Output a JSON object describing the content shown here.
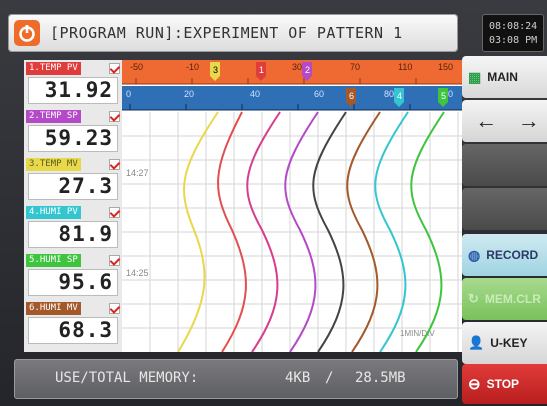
{
  "header": {
    "title": "[PROGRAM RUN]:EXPERIMENT OF PATTERN 1"
  },
  "clock": {
    "line1": "08:08:24",
    "line2": "03:08 PM"
  },
  "channels": [
    {
      "tag": "1.TEMP PV",
      "value": "31.92",
      "color": "#e03c3c",
      "text_color": "#ffffff"
    },
    {
      "tag": "2.TEMP SP",
      "value": "59.23",
      "color": "#b44ac8",
      "text_color": "#ffffff"
    },
    {
      "tag": "3.TEMP MV",
      "value": "27.3",
      "color": "#e8d84a",
      "text_color": "#5a5a22"
    },
    {
      "tag": "4.HUMI PV",
      "value": "81.9",
      "color": "#34c6d0",
      "text_color": "#ffffff"
    },
    {
      "tag": "5.HUMI SP",
      "value": "95.6",
      "color": "#3fc43f",
      "text_color": "#ffffff"
    },
    {
      "tag": "6.HUMI MV",
      "value": "68.3",
      "color": "#a3592a",
      "text_color": "#ffffff"
    }
  ],
  "graph": {
    "top_scale_labels": [
      "-50",
      "-10",
      "30",
      "70",
      "110",
      "150"
    ],
    "bottom_scale_labels": [
      "0",
      "20",
      "40",
      "60",
      "80",
      "100"
    ],
    "time_labels": [
      "14:27",
      "14:25"
    ],
    "interval_label": "1MIN/DIV",
    "colors": {
      "top_bar": "#ee6a32",
      "bottom_bar": "#2f6fb5"
    }
  },
  "buttons": {
    "main": "MAIN",
    "back": "←",
    "forward": "→",
    "record": "RECORD",
    "memory_clear": "MEM.CLR",
    "user_key": "U-KEY",
    "stop": "STOP"
  },
  "memory": {
    "label": "USE/TOTAL MEMORY:",
    "used": "4KB",
    "separator": "/",
    "total": "28.5MB"
  },
  "icons": [
    "power-logo-icon",
    "grid-icon",
    "record-icon",
    "memory-clear-icon",
    "user-icon",
    "stop-icon"
  ]
}
